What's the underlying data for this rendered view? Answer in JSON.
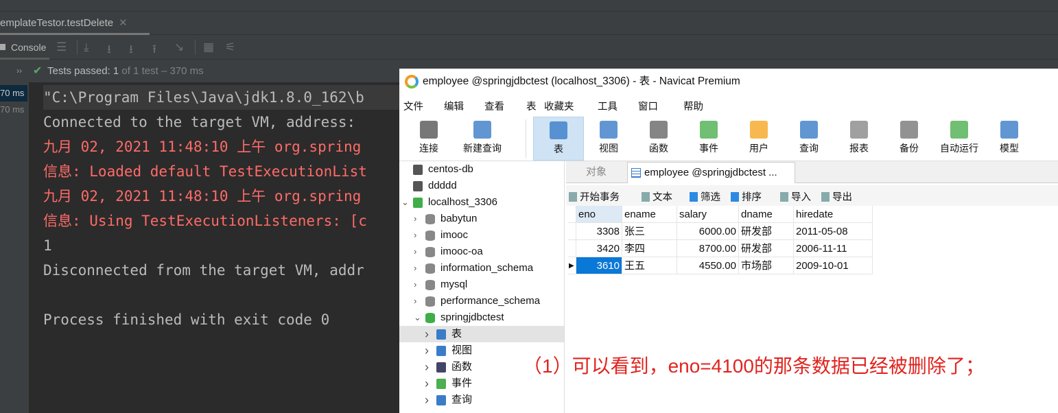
{
  "ide": {
    "run_tab": "emplateTestor.testDelete",
    "console_tab": "Console",
    "tests_prefix": "Tests passed:",
    "tests_count": "1",
    "tests_suffix": "of 1 test – 370 ms",
    "gutter_times": [
      "70 ms",
      "70 ms"
    ],
    "console_lines": [
      {
        "text": "\"C:\\Program Files\\Java\\jdk1.8.0_162\\b",
        "style": "normal"
      },
      {
        "text": "Connected to the target VM, address:",
        "style": "normal"
      },
      {
        "text": "九月 02, 2021 11:48:10 上午 org.spring",
        "style": "red"
      },
      {
        "text": "信息: Loaded default TestExecutionList",
        "style": "red"
      },
      {
        "text": "九月 02, 2021 11:48:10 上午 org.spring",
        "style": "red"
      },
      {
        "text": "信息: Using TestExecutionListeners: [c",
        "style": "red"
      },
      {
        "text": "1",
        "style": "normal"
      },
      {
        "text": "Disconnected from the target VM, addr",
        "style": "normal"
      },
      {
        "text": "",
        "style": "normal"
      },
      {
        "text": "Process finished with exit code 0",
        "style": "normal"
      }
    ]
  },
  "navicat": {
    "title": "employee @springjdbctest (localhost_3306) - 表 - Navicat Premium",
    "menu": [
      "文件",
      "编辑",
      "查看",
      "表",
      "收藏夹",
      "工具",
      "窗口",
      "帮助"
    ],
    "tools": [
      {
        "label": "连接",
        "color": "#555"
      },
      {
        "label": "新建查询",
        "color": "#3a7cc8"
      },
      {
        "label": "表",
        "color": "#3a7cc8",
        "active": true
      },
      {
        "label": "视图",
        "color": "#3a7cc8"
      },
      {
        "label": "函数",
        "color": "#666"
      },
      {
        "label": "事件",
        "color": "#4caf50"
      },
      {
        "label": "用户",
        "color": "#f5a623"
      },
      {
        "label": "查询",
        "color": "#3a7cc8"
      },
      {
        "label": "报表",
        "color": "#888"
      },
      {
        "label": "备份",
        "color": "#777"
      },
      {
        "label": "自动运行",
        "color": "#4caf50"
      },
      {
        "label": "模型",
        "color": "#3a7cc8"
      }
    ],
    "tree": [
      {
        "label": "centos-db",
        "level": 0,
        "icon": "connection-icon"
      },
      {
        "label": "ddddd",
        "level": 0,
        "icon": "connection-icon"
      },
      {
        "label": "localhost_3306",
        "level": 0,
        "icon": "connection-active-icon",
        "expanded": true
      },
      {
        "label": "babytun",
        "level": 1,
        "icon": "database-icon"
      },
      {
        "label": "imooc",
        "level": 1,
        "icon": "database-icon"
      },
      {
        "label": "imooc-oa",
        "level": 1,
        "icon": "database-icon"
      },
      {
        "label": "information_schema",
        "level": 1,
        "icon": "database-icon"
      },
      {
        "label": "mysql",
        "level": 1,
        "icon": "database-icon"
      },
      {
        "label": "performance_schema",
        "level": 1,
        "icon": "database-icon"
      },
      {
        "label": "springjdbctest",
        "level": 1,
        "icon": "database-active-icon",
        "expanded": true
      },
      {
        "label": "表",
        "level": 2,
        "icon": "table-icon",
        "selected": true
      },
      {
        "label": "视图",
        "level": 2,
        "icon": "view-icon"
      },
      {
        "label": "函数",
        "level": 2,
        "icon": "function-icon"
      },
      {
        "label": "事件",
        "level": 2,
        "icon": "event-icon"
      },
      {
        "label": "查询",
        "level": 2,
        "icon": "query-icon"
      }
    ],
    "tabs": {
      "objects": "对象",
      "table": "employee @springjdbctest ..."
    },
    "object_toolbar": [
      "开始事务",
      "文本",
      "筛选",
      "排序",
      "导入",
      "导出"
    ],
    "grid": {
      "columns": [
        "eno",
        "ename",
        "salary",
        "dname",
        "hiredate"
      ],
      "rows": [
        [
          "3308",
          "张三",
          "6000.00",
          "研发部",
          "2011-05-08"
        ],
        [
          "3420",
          "李四",
          "8700.00",
          "研发部",
          "2006-11-11"
        ],
        [
          "3610",
          "王五",
          "4550.00",
          "市场部",
          "2009-10-01"
        ]
      ]
    }
  },
  "annotation": "（1）可以看到，eno=4100的那条数据已经被删除了；",
  "colors": {
    "accent": "#0a78d7",
    "annotation": "#e0241f",
    "console_red": "#ff6b68"
  }
}
